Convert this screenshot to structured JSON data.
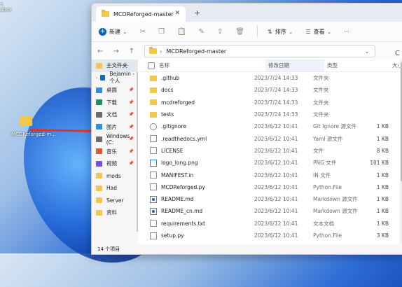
{
  "desktop": {
    "top_label": "e",
    "top_label2": "abox",
    "file_label": "MCDReforged-m..."
  },
  "window": {
    "tab_title": "MCDReforged-master",
    "tab_close": "✕",
    "tab_add": "+"
  },
  "toolbar": {
    "new_label": "新建",
    "new_chevron": "⌄",
    "sort_label": "排序",
    "view_label": "查看",
    "more": "···"
  },
  "address": {
    "back": "←",
    "forward": "→",
    "up": "↑",
    "path": "MCDReforged-master",
    "chevron": "›",
    "refresh": "C"
  },
  "sidebar": {
    "items": [
      {
        "label": "主文件夹",
        "icon": "home-icon",
        "color": "#f3c74c",
        "active": true
      },
      {
        "label": "Bejamin - 个人",
        "icon": "cloud-icon",
        "color": "#0f6cbd",
        "expand": "›"
      },
      {
        "label": "桌面",
        "icon": "desktop-icon",
        "color": "#3a89e0",
        "pin": "📌"
      },
      {
        "label": "下载",
        "icon": "download-icon",
        "color": "#1f8f5a",
        "pin": "📌"
      },
      {
        "label": "文档",
        "icon": "document-icon",
        "color": "#6b6b6b",
        "pin": "📌"
      },
      {
        "label": "图片",
        "icon": "picture-icon",
        "color": "#2d8de0",
        "pin": "📌"
      },
      {
        "label": "Windows (C:",
        "icon": "drive-icon",
        "color": "#6b6b6b",
        "pin": "📌"
      },
      {
        "label": "音乐",
        "icon": "music-icon",
        "color": "#e05a2b",
        "pin": "📌"
      },
      {
        "label": "视频",
        "icon": "video-icon",
        "color": "#7a4be0",
        "pin": "📌"
      },
      {
        "label": "mods",
        "icon": "folder-icon",
        "color": "#f3c74c"
      },
      {
        "label": "Had",
        "icon": "folder-icon",
        "color": "#f3c74c"
      },
      {
        "label": "Server",
        "icon": "folder-icon",
        "color": "#f3c74c"
      },
      {
        "label": "资料",
        "icon": "folder-icon",
        "color": "#f3c74c"
      }
    ]
  },
  "columns": {
    "name": "名称",
    "date": "修改日期",
    "type": "类型",
    "size": "大小"
  },
  "files": [
    {
      "name": ".github",
      "date": "2023/7/24 14:33",
      "type": "文件夹",
      "size": "",
      "kind": "folder"
    },
    {
      "name": "docs",
      "date": "2023/7/24 14:33",
      "type": "文件夹",
      "size": "",
      "kind": "folder"
    },
    {
      "name": "mcdreforged",
      "date": "2023/7/24 14:33",
      "type": "文件夹",
      "size": "",
      "kind": "folder"
    },
    {
      "name": "tests",
      "date": "2023/7/24 14:33",
      "type": "文件夹",
      "size": "",
      "kind": "folder"
    },
    {
      "name": ".gitignore",
      "date": "2023/6/12 10:41",
      "type": "Git Ignore 源文件",
      "size": "1 KB",
      "kind": "git"
    },
    {
      "name": ".readthedocs.yml",
      "date": "2023/6/12 10:41",
      "type": "Yaml 源文件",
      "size": "1 KB",
      "kind": "doc"
    },
    {
      "name": "LICENSE",
      "date": "2023/6/12 10:41",
      "type": "文件",
      "size": "8 KB",
      "kind": "doc"
    },
    {
      "name": "logo_long.png",
      "date": "2023/6/12 10:41",
      "type": "PNG 文件",
      "size": "101 KB",
      "kind": "img"
    },
    {
      "name": "MANIFEST.in",
      "date": "2023/6/12 10:41",
      "type": "IN 文件",
      "size": "1 KB",
      "kind": "doc"
    },
    {
      "name": "MCDReforged.py",
      "date": "2023/6/12 10:41",
      "type": "Python.File",
      "size": "1 KB",
      "kind": "py"
    },
    {
      "name": "README.md",
      "date": "2023/6/12 10:41",
      "type": "Markdown 源文件",
      "size": "1 KB",
      "kind": "md"
    },
    {
      "name": "README_cn.md",
      "date": "2023/6/12 10:41",
      "type": "Markdown 源文件",
      "size": "1 KB",
      "kind": "md"
    },
    {
      "name": "requirements.txt",
      "date": "2023/6/12 10:41",
      "type": "文本文档",
      "size": "1 KB",
      "kind": "doc"
    },
    {
      "name": "setup.py",
      "date": "2023/6/12 10:41",
      "type": "Python.File",
      "size": "3 KB",
      "kind": "py"
    }
  ],
  "status": {
    "count": "14 个项目"
  }
}
